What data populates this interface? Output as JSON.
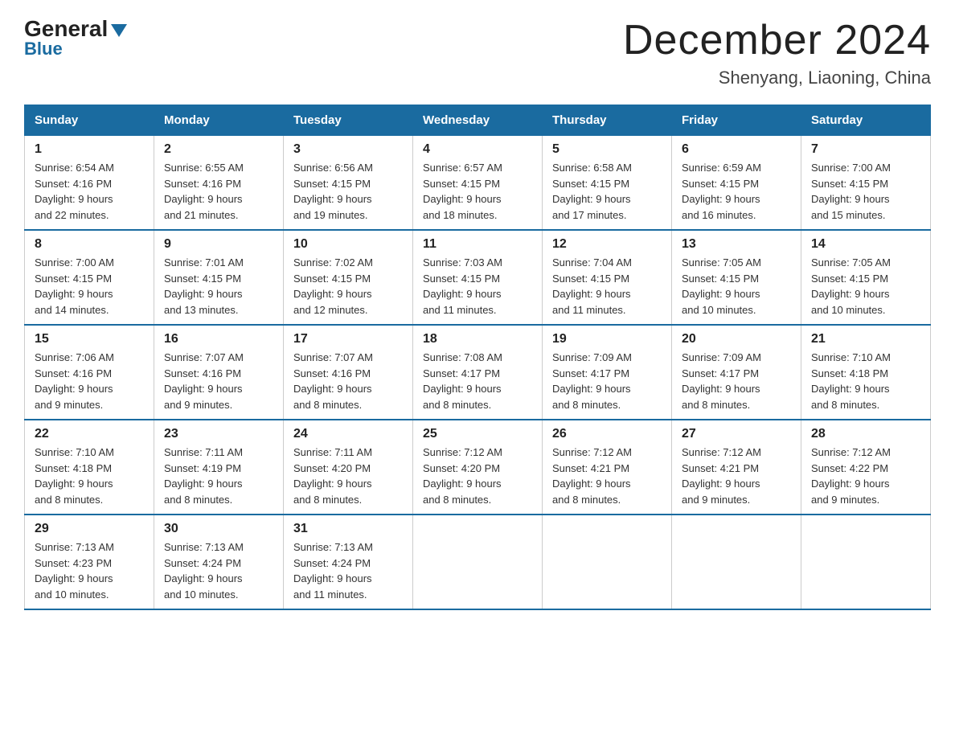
{
  "logo": {
    "general": "General",
    "blue": "Blue"
  },
  "title": "December 2024",
  "subtitle": "Shenyang, Liaoning, China",
  "days_of_week": [
    "Sunday",
    "Monday",
    "Tuesday",
    "Wednesday",
    "Thursday",
    "Friday",
    "Saturday"
  ],
  "weeks": [
    [
      {
        "day": "1",
        "sunrise": "6:54 AM",
        "sunset": "4:16 PM",
        "daylight": "9 hours and 22 minutes."
      },
      {
        "day": "2",
        "sunrise": "6:55 AM",
        "sunset": "4:16 PM",
        "daylight": "9 hours and 21 minutes."
      },
      {
        "day": "3",
        "sunrise": "6:56 AM",
        "sunset": "4:15 PM",
        "daylight": "9 hours and 19 minutes."
      },
      {
        "day": "4",
        "sunrise": "6:57 AM",
        "sunset": "4:15 PM",
        "daylight": "9 hours and 18 minutes."
      },
      {
        "day": "5",
        "sunrise": "6:58 AM",
        "sunset": "4:15 PM",
        "daylight": "9 hours and 17 minutes."
      },
      {
        "day": "6",
        "sunrise": "6:59 AM",
        "sunset": "4:15 PM",
        "daylight": "9 hours and 16 minutes."
      },
      {
        "day": "7",
        "sunrise": "7:00 AM",
        "sunset": "4:15 PM",
        "daylight": "9 hours and 15 minutes."
      }
    ],
    [
      {
        "day": "8",
        "sunrise": "7:00 AM",
        "sunset": "4:15 PM",
        "daylight": "9 hours and 14 minutes."
      },
      {
        "day": "9",
        "sunrise": "7:01 AM",
        "sunset": "4:15 PM",
        "daylight": "9 hours and 13 minutes."
      },
      {
        "day": "10",
        "sunrise": "7:02 AM",
        "sunset": "4:15 PM",
        "daylight": "9 hours and 12 minutes."
      },
      {
        "day": "11",
        "sunrise": "7:03 AM",
        "sunset": "4:15 PM",
        "daylight": "9 hours and 11 minutes."
      },
      {
        "day": "12",
        "sunrise": "7:04 AM",
        "sunset": "4:15 PM",
        "daylight": "9 hours and 11 minutes."
      },
      {
        "day": "13",
        "sunrise": "7:05 AM",
        "sunset": "4:15 PM",
        "daylight": "9 hours and 10 minutes."
      },
      {
        "day": "14",
        "sunrise": "7:05 AM",
        "sunset": "4:15 PM",
        "daylight": "9 hours and 10 minutes."
      }
    ],
    [
      {
        "day": "15",
        "sunrise": "7:06 AM",
        "sunset": "4:16 PM",
        "daylight": "9 hours and 9 minutes."
      },
      {
        "day": "16",
        "sunrise": "7:07 AM",
        "sunset": "4:16 PM",
        "daylight": "9 hours and 9 minutes."
      },
      {
        "day": "17",
        "sunrise": "7:07 AM",
        "sunset": "4:16 PM",
        "daylight": "9 hours and 8 minutes."
      },
      {
        "day": "18",
        "sunrise": "7:08 AM",
        "sunset": "4:17 PM",
        "daylight": "9 hours and 8 minutes."
      },
      {
        "day": "19",
        "sunrise": "7:09 AM",
        "sunset": "4:17 PM",
        "daylight": "9 hours and 8 minutes."
      },
      {
        "day": "20",
        "sunrise": "7:09 AM",
        "sunset": "4:17 PM",
        "daylight": "9 hours and 8 minutes."
      },
      {
        "day": "21",
        "sunrise": "7:10 AM",
        "sunset": "4:18 PM",
        "daylight": "9 hours and 8 minutes."
      }
    ],
    [
      {
        "day": "22",
        "sunrise": "7:10 AM",
        "sunset": "4:18 PM",
        "daylight": "9 hours and 8 minutes."
      },
      {
        "day": "23",
        "sunrise": "7:11 AM",
        "sunset": "4:19 PM",
        "daylight": "9 hours and 8 minutes."
      },
      {
        "day": "24",
        "sunrise": "7:11 AM",
        "sunset": "4:20 PM",
        "daylight": "9 hours and 8 minutes."
      },
      {
        "day": "25",
        "sunrise": "7:12 AM",
        "sunset": "4:20 PM",
        "daylight": "9 hours and 8 minutes."
      },
      {
        "day": "26",
        "sunrise": "7:12 AM",
        "sunset": "4:21 PM",
        "daylight": "9 hours and 8 minutes."
      },
      {
        "day": "27",
        "sunrise": "7:12 AM",
        "sunset": "4:21 PM",
        "daylight": "9 hours and 9 minutes."
      },
      {
        "day": "28",
        "sunrise": "7:12 AM",
        "sunset": "4:22 PM",
        "daylight": "9 hours and 9 minutes."
      }
    ],
    [
      {
        "day": "29",
        "sunrise": "7:13 AM",
        "sunset": "4:23 PM",
        "daylight": "9 hours and 10 minutes."
      },
      {
        "day": "30",
        "sunrise": "7:13 AM",
        "sunset": "4:24 PM",
        "daylight": "9 hours and 10 minutes."
      },
      {
        "day": "31",
        "sunrise": "7:13 AM",
        "sunset": "4:24 PM",
        "daylight": "9 hours and 11 minutes."
      },
      null,
      null,
      null,
      null
    ]
  ],
  "labels": {
    "sunrise": "Sunrise:",
    "sunset": "Sunset:",
    "daylight": "Daylight:"
  }
}
